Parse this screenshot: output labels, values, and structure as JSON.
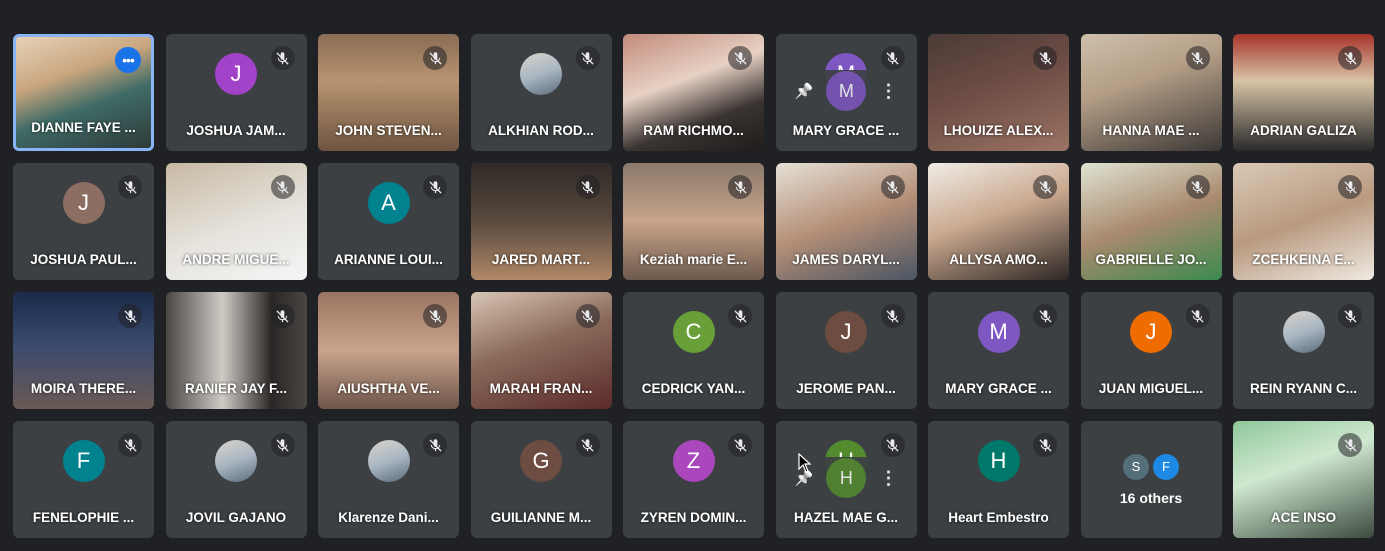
{
  "participants": [
    {
      "name": "DIANNE FAYE ...",
      "type": "video",
      "active": true,
      "more_menu": true,
      "bg": "linear-gradient(160deg,#e6d3b8 0%,#c9a57e 35%,#3f6b66 60%,#2e3a3a 100%)"
    },
    {
      "name": "JOSHUA JAM...",
      "type": "avatar",
      "initial": "J",
      "color": "#a142c8",
      "muted": true
    },
    {
      "name": "JOHN STEVEN...",
      "type": "video",
      "muted": true,
      "bg": "linear-gradient(180deg,#8a6c55 0%,#b89470 40%,#6e5441 100%)"
    },
    {
      "name": "ALKHIAN ROD...",
      "type": "photo-avatar",
      "muted": true
    },
    {
      "name": "RAM RICHMO...",
      "type": "video",
      "muted": true,
      "bg": "linear-gradient(160deg,#c28b7a 0%,#e7d1c4 40%,#3a3432 70%,#1f1c1b 100%)"
    },
    {
      "name": "MARY GRACE ...",
      "type": "avatar",
      "initial": "M",
      "color": "#7e57c2",
      "muted": true,
      "hover": true
    },
    {
      "name": "LHOUIZE ALEX...",
      "type": "video",
      "muted": true,
      "bg": "linear-gradient(160deg,#4a3a36 0%,#6e4d45 45%,#9a7363 100%)"
    },
    {
      "name": "HANNA MAE ...",
      "type": "video",
      "muted": true,
      "bg": "linear-gradient(160deg,#cfc0aa 0%,#b39d86 40%,#3c3836 100%)"
    },
    {
      "name": "ADRIAN GALIZA",
      "type": "video",
      "muted": true,
      "bg": "linear-gradient(180deg,#a7332a 0%,#d7c4a6 40%,#2a2a2a 100%)"
    },
    {
      "name": "JOSHUA PAUL...",
      "type": "avatar",
      "initial": "J",
      "color": "#8d6e63",
      "muted": true
    },
    {
      "name": "ANDRE MIGUE...",
      "type": "video",
      "muted": true,
      "bg": "linear-gradient(160deg,#c7b9a3 0%,#e6e3dd 55%,#f5f5f5 100%)"
    },
    {
      "name": "ARIANNE LOUI...",
      "type": "avatar",
      "initial": "A",
      "color": "#00838f",
      "muted": true
    },
    {
      "name": "JARED MART...",
      "type": "video",
      "muted": true,
      "bg": "linear-gradient(180deg,#2f2a27 0%,#5a4a3e 50%,#b08868 100%)"
    },
    {
      "name": "Keziah marie E...",
      "type": "video",
      "muted": true,
      "bg": "linear-gradient(180deg,#8a7a6a 0%,#c8a48a 50%,#6d5a4c 100%)"
    },
    {
      "name": "JAMES DARYL...",
      "type": "video",
      "muted": true,
      "bg": "linear-gradient(160deg,#e5e0d6 0%,#b58f77 50%,#4a5563 100%)"
    },
    {
      "name": "ALLYSA AMO...",
      "type": "video",
      "muted": true,
      "bg": "linear-gradient(160deg,#f0ece6 0%,#caa98f 45%,#2d2624 100%)"
    },
    {
      "name": "GABRIELLE JO...",
      "type": "video",
      "muted": true,
      "bg": "linear-gradient(160deg,#dfe3d2 0%,#a98a6e 50%,#3b8a4f 100%)"
    },
    {
      "name": "ZCEHKEINA E...",
      "type": "video",
      "muted": true,
      "bg": "linear-gradient(160deg,#d9c9b6 0%,#b99a80 50%,#efe9e1 100%)"
    },
    {
      "name": "MOIRA THERE...",
      "type": "video",
      "muted": true,
      "bg": "linear-gradient(180deg,#1b2a4a 0%,#3a4a6e 45%,#6b5a55 100%)"
    },
    {
      "name": "RANIER JAY F...",
      "type": "video",
      "muted": true,
      "bg": "linear-gradient(90deg,#4a4644 0%,#cfcac4 40%,#2a2726 75%,#4a4644 100%)"
    },
    {
      "name": "AIUSHTHA VE...",
      "type": "video",
      "muted": true,
      "bg": "linear-gradient(180deg,#9a7460 0%,#c9a48c 50%,#6e544a 100%)"
    },
    {
      "name": "MARAH FRAN...",
      "type": "video",
      "muted": true,
      "bg": "linear-gradient(160deg,#d9c5b4 0%,#8a6a5a 45%,#5a2a2a 100%)"
    },
    {
      "name": "CEDRICK YAN...",
      "type": "avatar",
      "initial": "C",
      "color": "#689f38",
      "muted": true
    },
    {
      "name": "JEROME PAN...",
      "type": "avatar",
      "initial": "J",
      "color": "#6d4c41",
      "muted": true
    },
    {
      "name": "MARY GRACE ...",
      "type": "avatar",
      "initial": "M",
      "color": "#7e57c2",
      "muted": true
    },
    {
      "name": "JUAN MIGUEL...",
      "type": "avatar",
      "initial": "J",
      "color": "#ef6c00",
      "muted": true
    },
    {
      "name": "REIN RYANN C...",
      "type": "photo-avatar",
      "muted": true
    },
    {
      "name": "FENELOPHIE ...",
      "type": "avatar",
      "initial": "F",
      "color": "#00838f",
      "muted": true
    },
    {
      "name": "JOVIL GAJANO",
      "type": "photo-avatar",
      "muted": true
    },
    {
      "name": "Klarenze Dani...",
      "type": "photo-avatar",
      "muted": true
    },
    {
      "name": "GUILIANNE M...",
      "type": "avatar",
      "initial": "G",
      "color": "#6d4c41",
      "muted": true
    },
    {
      "name": "ZYREN DOMIN...",
      "type": "avatar",
      "initial": "Z",
      "color": "#ab47bc",
      "muted": true
    },
    {
      "name": "HAZEL MAE G...",
      "type": "avatar",
      "initial": "H",
      "color": "#558b2f",
      "muted": true,
      "hover": true
    },
    {
      "name": "Heart Embestro",
      "type": "avatar",
      "initial": "H",
      "color": "#00796b",
      "muted": true
    },
    {
      "name": "16 others",
      "type": "others",
      "initials": [
        "S",
        "F"
      ],
      "colors": [
        "#546e7a",
        "#1e88e5"
      ]
    },
    {
      "name": "ACE INSO",
      "type": "video",
      "muted": true,
      "bg": "linear-gradient(160deg,#8fc79a 0%,#cfe8d0 40%,#3c4a3e 100%)"
    }
  ]
}
